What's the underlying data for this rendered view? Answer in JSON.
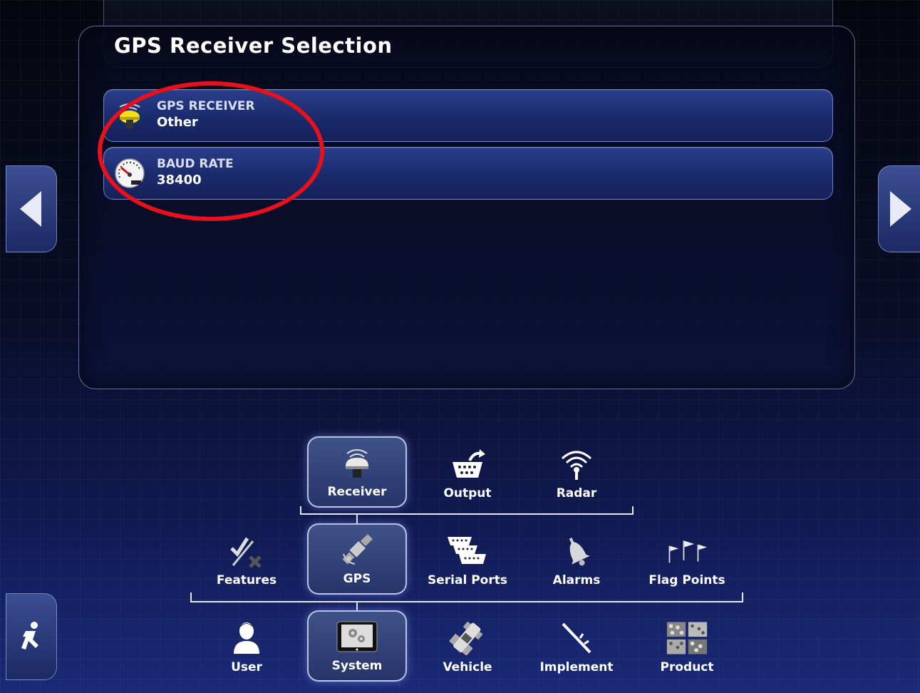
{
  "panel": {
    "title": "GPS Receiver Selection",
    "settings": [
      {
        "label": "GPS RECEIVER",
        "value": "Other",
        "icon": "gps-receiver-icon"
      },
      {
        "label": "BAUD RATE",
        "value": "38400",
        "icon": "gauge-icon"
      }
    ]
  },
  "side_nav": {
    "left_icon": "arrow-left-icon",
    "right_icon": "arrow-right-icon",
    "exit_icon": "running-man-icon"
  },
  "menu": {
    "level3": [
      {
        "label": "Receiver",
        "icon": "gps-receiver-icon",
        "selected": true
      },
      {
        "label": "Output",
        "icon": "output-icon",
        "selected": false
      },
      {
        "label": "Radar",
        "icon": "radar-icon",
        "selected": false
      }
    ],
    "level2": [
      {
        "label": "Features",
        "icon": "check-x-icon",
        "selected": false
      },
      {
        "label": "GPS",
        "icon": "satellite-icon",
        "selected": true
      },
      {
        "label": "Serial Ports",
        "icon": "serial-ports-icon",
        "selected": false
      },
      {
        "label": "Alarms",
        "icon": "bell-icon",
        "selected": false
      },
      {
        "label": "Flag Points",
        "icon": "flags-icon",
        "selected": false
      }
    ],
    "level1": [
      {
        "label": "User",
        "icon": "user-icon",
        "selected": false
      },
      {
        "label": "System",
        "icon": "system-icon",
        "selected": true
      },
      {
        "label": "Vehicle",
        "icon": "vehicle-icon",
        "selected": false
      },
      {
        "label": "Implement",
        "icon": "implement-icon",
        "selected": false
      },
      {
        "label": "Product",
        "icon": "product-icon",
        "selected": false
      }
    ]
  },
  "colors": {
    "highlight": "#e8101a",
    "row_bg": "#1a2b6c",
    "selected_bg": "#3f5288"
  }
}
